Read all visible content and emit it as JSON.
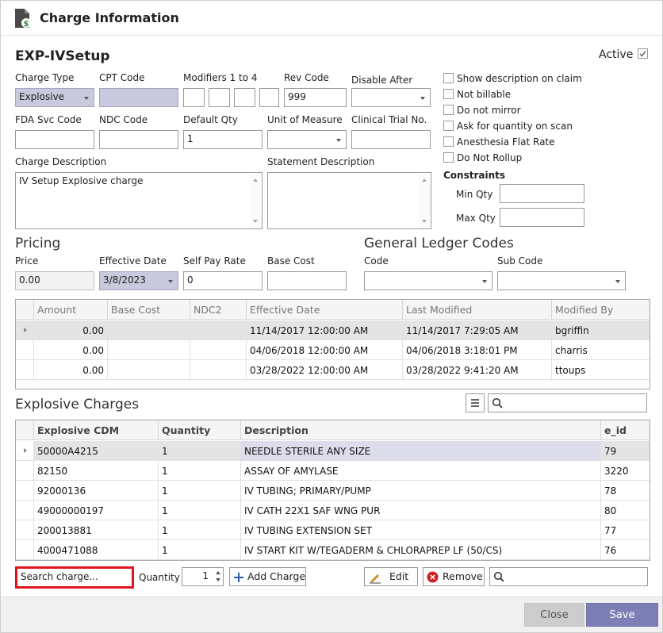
{
  "window": {
    "title": "Charge Information",
    "icon": "document-dollar-icon"
  },
  "header": {
    "name": "EXP-IVSetup",
    "active_label": "Active",
    "active_checked": true
  },
  "form": {
    "charge_type": {
      "label": "Charge Type",
      "value": "Explosive"
    },
    "cpt_code": {
      "label": "CPT Code",
      "value": ""
    },
    "modifiers": {
      "label": "Modifiers 1 to 4",
      "values": [
        "",
        "",
        "",
        ""
      ]
    },
    "rev_code": {
      "label": "Rev Code",
      "value": "999"
    },
    "disable_after": {
      "label": "Disable After",
      "value": ""
    },
    "fda_svc_code": {
      "label": "FDA Svc Code",
      "value": ""
    },
    "ndc_code": {
      "label": "NDC Code",
      "value": ""
    },
    "default_qty": {
      "label": "Default Qty",
      "value": "1"
    },
    "unit_of_measure": {
      "label": "Unit of Measure",
      "value": ""
    },
    "clinical_trial_no": {
      "label": "Clinical Trial No.",
      "value": ""
    },
    "charge_description": {
      "label": "Charge Description",
      "value": "IV Setup Explosive charge"
    },
    "statement_description": {
      "label": "Statement Description",
      "value": ""
    }
  },
  "options": [
    {
      "label": "Show description on claim",
      "checked": false
    },
    {
      "label": "Not billable",
      "checked": false
    },
    {
      "label": "Do not mirror",
      "checked": false
    },
    {
      "label": "Ask for quantity on scan",
      "checked": false
    },
    {
      "label": "Anesthesia Flat Rate",
      "checked": false
    },
    {
      "label": "Do Not Rollup",
      "checked": false
    }
  ],
  "constraints": {
    "title": "Constraints",
    "min_qty": {
      "label": "Min Qty",
      "value": ""
    },
    "max_qty": {
      "label": "Max Qty",
      "value": ""
    }
  },
  "pricing": {
    "title": "Pricing",
    "price": {
      "label": "Price",
      "value": "0.00"
    },
    "effective_date": {
      "label": "Effective Date",
      "value": "3/8/2023"
    },
    "self_pay_rate": {
      "label": "Self Pay Rate",
      "value": "0"
    },
    "base_cost": {
      "label": "Base Cost",
      "value": ""
    }
  },
  "gl_codes": {
    "title": "General Ledger Codes",
    "code": {
      "label": "Code",
      "value": ""
    },
    "sub_code": {
      "label": "Sub Code",
      "value": ""
    }
  },
  "price_history": {
    "columns": [
      "Amount",
      "Base Cost",
      "NDC2",
      "Effective Date",
      "Last Modified",
      "Modified By"
    ],
    "rows": [
      [
        "0.00",
        "",
        "",
        "11/14/2017 12:00:00 AM",
        "11/14/2017 7:29:05 AM",
        "bgriffin"
      ],
      [
        "0.00",
        "",
        "",
        "04/06/2018 12:00:00 AM",
        "04/06/2018 3:18:01 PM",
        "charris"
      ],
      [
        "0.00",
        "",
        "",
        "03/28/2022 12:00:00 AM",
        "03/28/2022 9:41:20 AM",
        "ttoups"
      ]
    ]
  },
  "explosive": {
    "title": "Explosive Charges",
    "search_placeholder": "",
    "columns": [
      "Explosive CDM",
      "Quantity",
      "Description",
      "e_id"
    ],
    "rows": [
      [
        "50000A4215",
        "1",
        "NEEDLE STERILE ANY SIZE",
        "79"
      ],
      [
        "82150",
        "1",
        "ASSAY OF AMYLASE",
        "3220"
      ],
      [
        "92000136",
        "1",
        "IV TUBING; PRIMARY/PUMP",
        "78"
      ],
      [
        "49000000197",
        "1",
        "IV CATH 22X1 SAF WNG PUR",
        "80"
      ],
      [
        "200013881",
        "1",
        "IV TUBING EXTENSION SET",
        "77"
      ],
      [
        "4000471088",
        "1",
        "IV START KIT W/TEGADERM & CHLORAPREP LF (50/CS)",
        "76"
      ]
    ]
  },
  "toolbar": {
    "search_charge_placeholder": "Search charge...",
    "quantity_label": "Quantity",
    "quantity_value": "1",
    "add_charge_label": "Add Charge",
    "edit_label": "Edit",
    "remove_label": "Remove"
  },
  "footer": {
    "close_label": "Close",
    "save_label": "Save"
  },
  "colors": {
    "accent": "#7d7fb4",
    "selected_field": "#c8c9dd",
    "highlight_border": "#e0141e",
    "remove_red": "#d02020"
  }
}
